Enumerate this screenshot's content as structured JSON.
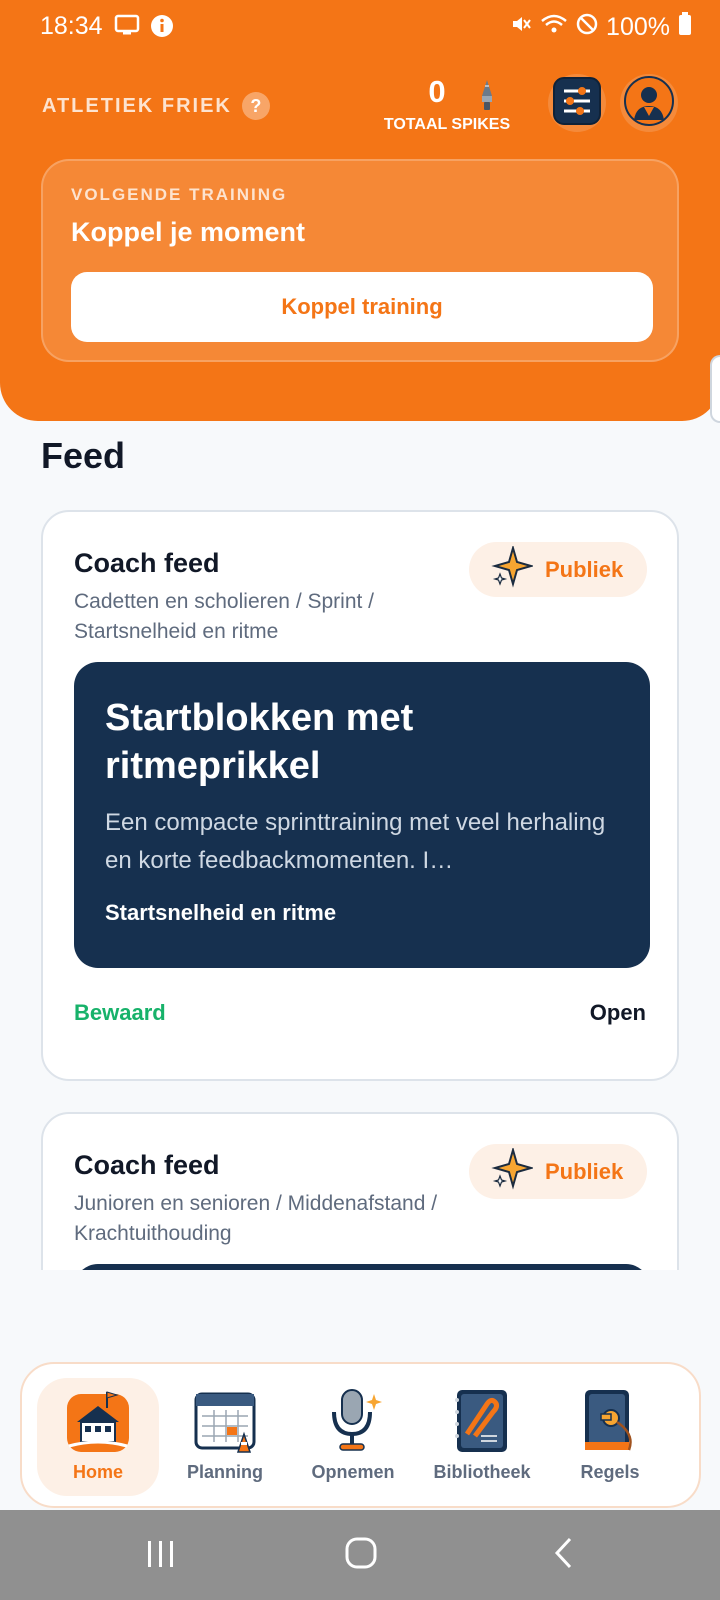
{
  "status_bar": {
    "time": "18:34",
    "battery": "100%",
    "icons": [
      "screen-cast-icon",
      "info-icon",
      "mute-icon",
      "wifi-icon",
      "do-not-disturb-icon",
      "battery-icon"
    ]
  },
  "header": {
    "club_name": "ATLETIEK FRIEK",
    "help": "?",
    "spikes_count": "0",
    "spikes_label": "TOTAAL SPIKES",
    "next_training": {
      "label": "VOLGENDE TRAINING",
      "title": "Koppel je moment",
      "button": "Koppel training"
    }
  },
  "feed": {
    "title": "Feed",
    "items": [
      {
        "title": "Coach feed",
        "path": "Cadetten en scholieren / Sprint / Startsnelheid en ritme",
        "badge": "Publiek",
        "session_title": "Startblokken met ritmeprikkel",
        "session_description": "Een compacte sprinttraining met veel herhaling en korte feedbackmomenten. I…",
        "session_tag": "Startsnelheid en ritme",
        "saved_label": "Bewaard",
        "open_label": "Open"
      },
      {
        "title": "Coach feed",
        "path": "Junioren en senioren / Middenafstand / Krachtuithouding",
        "badge": "Publiek"
      }
    ]
  },
  "nav": {
    "items": [
      {
        "label": "Home",
        "icon": "home-icon",
        "active": true
      },
      {
        "label": "Planning",
        "icon": "calendar-icon"
      },
      {
        "label": "Opnemen",
        "icon": "microphone-icon"
      },
      {
        "label": "Bibliotheek",
        "icon": "library-icon"
      },
      {
        "label": "Regels",
        "icon": "rules-book-icon"
      }
    ]
  },
  "colors": {
    "accent": "#f47516",
    "navy": "#16304f",
    "success": "#17b26a"
  }
}
